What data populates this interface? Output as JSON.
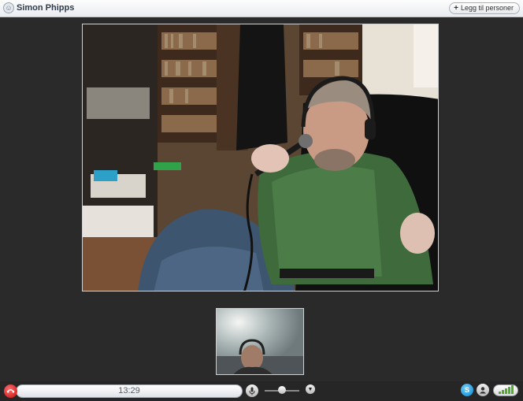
{
  "window": {
    "contact_name": "Simon Phipps",
    "add_people_label": "Legg til personer"
  },
  "call": {
    "duration": "13:29",
    "volume_level": 0.5
  },
  "icons": {
    "title": "skype-contact-icon",
    "add": "plus-icon",
    "hangup": "phone-hangup-icon",
    "mic": "microphone-icon",
    "volume": "volume-slider",
    "more": "chevron-down-icon",
    "skype": "skype-icon",
    "contact": "contact-icon",
    "signal": "signal-strength-icon"
  },
  "colors": {
    "hangup": "#d01a1a",
    "skype": "#0a86c9",
    "signal": "#4caf28",
    "background": "#2a2a2a"
  }
}
